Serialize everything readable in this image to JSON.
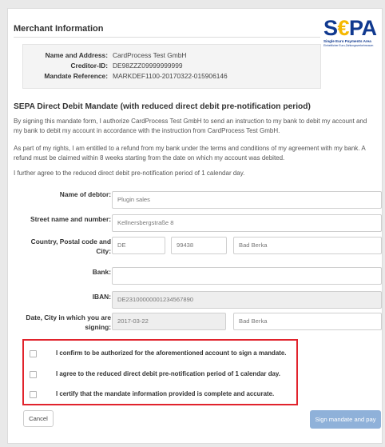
{
  "merchant": {
    "title": "Merchant Information",
    "name_label": "Name and Address:",
    "name_value": "CardProcess Test GmbH",
    "creditor_label": "Creditor-ID:",
    "creditor_value": "DE98ZZZ09999999999",
    "mandate_label": "Mandate Reference:",
    "mandate_value": "MARKDEF1100-20170322-015906146"
  },
  "logo": {
    "word_prefix": "S",
    "word_euro": "€",
    "word_suffix": "PA",
    "subtitle": "Single Euro Payments Area",
    "subtitle_small": "Einheitlicher Euro-Zahlungsverkehrsraum",
    "colors": {
      "blue": "#10398f",
      "yellow": "#f5b800"
    }
  },
  "mandate": {
    "title": "SEPA Direct Debit Mandate (with reduced direct debit pre-notification period)",
    "para1_line1": "By signing this mandate form, I authorize CardProcess Test GmbH to send an instruction to my bank to debit my account and",
    "para1_line2": "my bank to debit my account in accordance with the instruction from CardProcess Test GmbH.",
    "para2_line1": "As part of my rights, I am entitled to a refund from my bank under the terms and conditions of my agreement with my bank. A",
    "para2_line2": "refund must be claimed within 8 weeks starting from the date on which my account was debited.",
    "para3": "I further agree to the reduced direct debit pre-notification period of 1 calendar day."
  },
  "form": {
    "debtor_label": "Name of debtor:",
    "debtor_value": "Plugin sales",
    "street_label": "Street name and number:",
    "street_value": "Kellnersbergstraße 8",
    "country_label_line1": "Country, Postal code and",
    "country_label_line2": "City:",
    "country_value": "DE",
    "postal_value": "99438",
    "city_value": "Bad Berka",
    "bank_label": "Bank:",
    "bank_value": "",
    "iban_label": "IBAN:",
    "iban_value": "DE23100000001234567890",
    "date_label_line1": "Date, City in which you are",
    "date_label_line2": "signing:",
    "date_value": "2017-03-22",
    "sign_city_value": "Bad Berka"
  },
  "consents": [
    "I confirm to be authorized for the aforementioned account to sign a mandate.",
    "I agree to the reduced direct debit pre-notification period of 1 calendar day.",
    "I certify that the mandate information provided is complete and accurate."
  ],
  "buttons": {
    "cancel": "Cancel",
    "submit": "Sign mandate and pay"
  },
  "colors": {
    "consent_border": "#e1232c",
    "submit_bg": "#8fb1d9"
  }
}
